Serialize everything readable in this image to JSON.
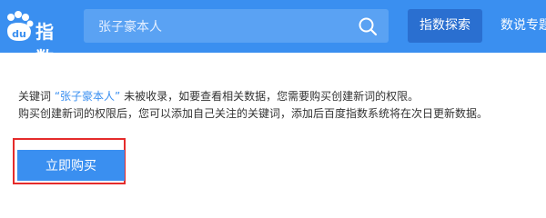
{
  "header": {
    "logo_text": "指数",
    "search": {
      "value": "张子豪本人",
      "placeholder": ""
    },
    "nav_active_label": "指数探索",
    "nav_next_label": "数说专题"
  },
  "message": {
    "line1_prefix": "关键词",
    "line1_keyword": "“张子豪本人”",
    "line1_suffix": "未被收录，如要查看相关数据，您需要购买创建新词的权限。",
    "line2": "购买创建新词的权限后，您可以添加自己关注的关键词，添加后百度指数系统将在次日更新数据。"
  },
  "buy_button_label": "立即购买",
  "colors": {
    "header_bg": "#3a8ff0",
    "button_bg": "#3a8ff0",
    "highlight": "#e52b2b",
    "keyword": "#3a8ff0"
  }
}
